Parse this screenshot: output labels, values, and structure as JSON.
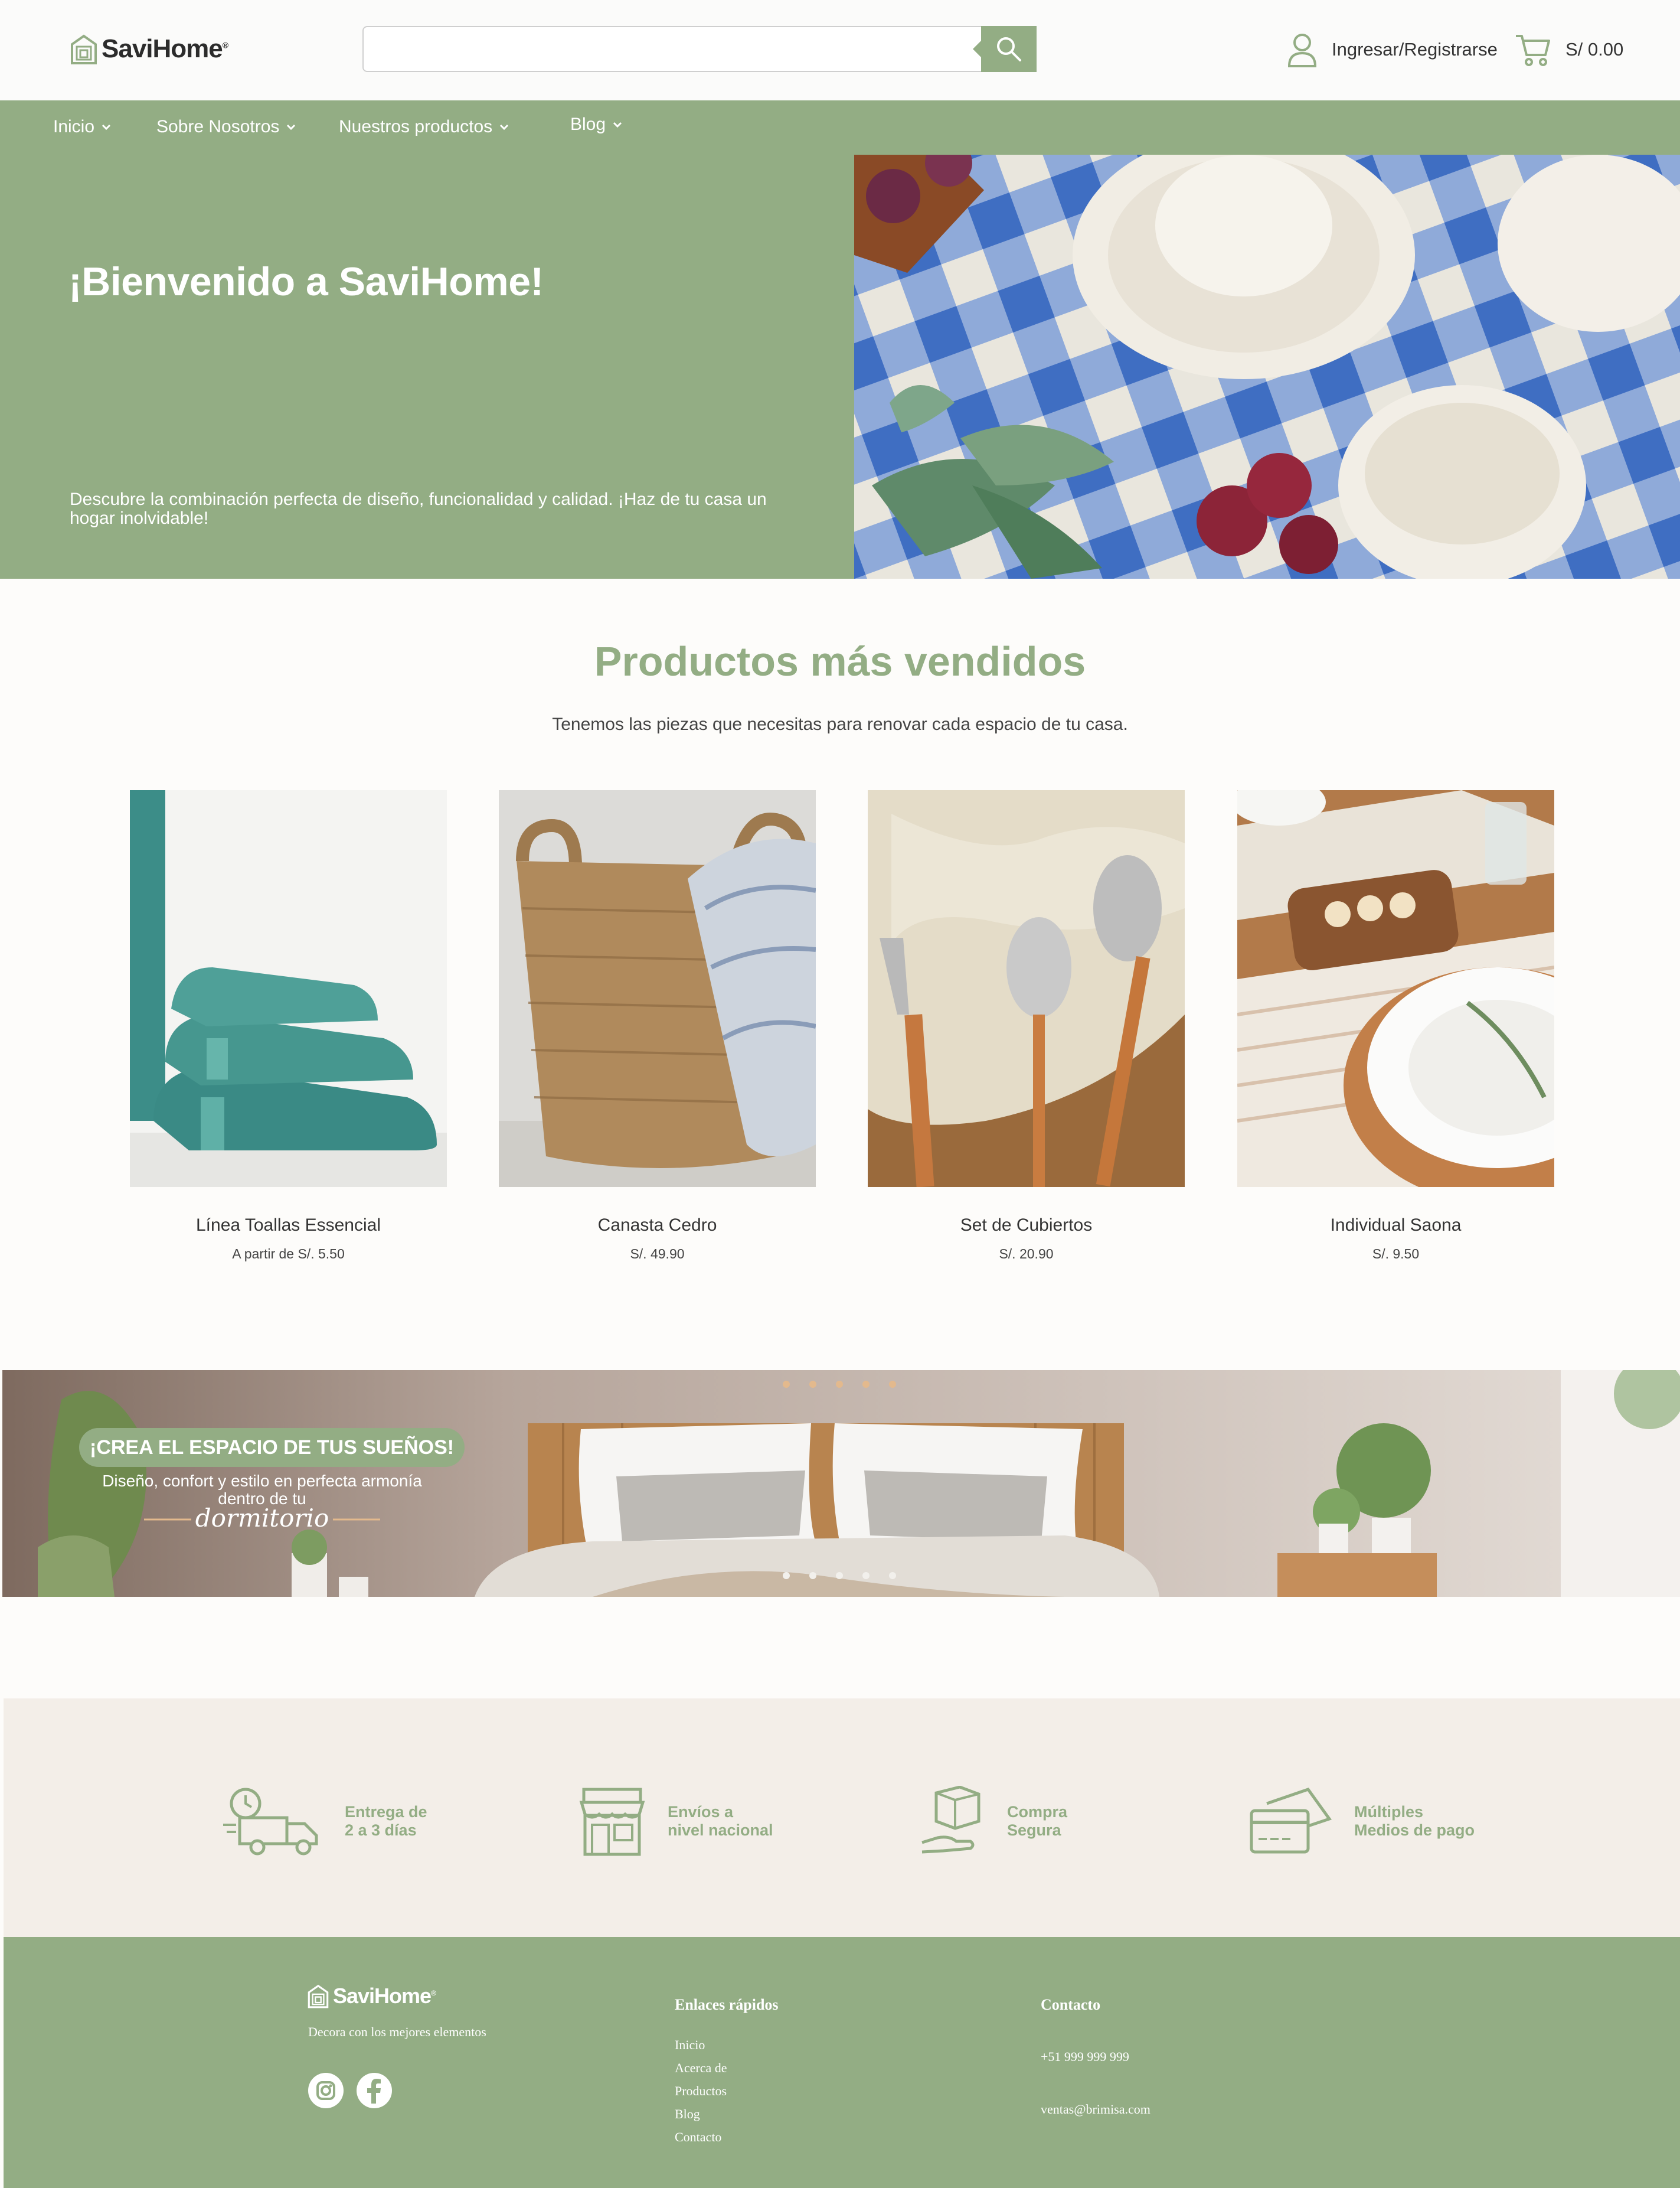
{
  "header": {
    "logo_text": "SaviHome",
    "logo_mark": "®",
    "search": {
      "placeholder": "",
      "value": ""
    },
    "login_label": "Ingresar/Registrarse",
    "cart_total": "S/ 0.00"
  },
  "nav": {
    "items": [
      {
        "label": "Inicio"
      },
      {
        "label": "Sobre Nosotros"
      },
      {
        "label": "Nuestros productos"
      },
      {
        "label": "Blog"
      }
    ]
  },
  "hero": {
    "title": "¡Bienvenido a SaviHome!",
    "subtitle": "Descubre la combinación perfecta de diseño, funcionalidad y calidad. ¡Haz de tu casa un hogar inolvidable!"
  },
  "bestsellers": {
    "title": "Productos más vendidos",
    "subtitle": "Tenemos las piezas que necesitas para renovar cada espacio de tu casa.",
    "products": [
      {
        "name": "Línea Toallas Essencial",
        "price": "A partir de S/. 5.50"
      },
      {
        "name": "Canasta Cedro",
        "price": "S/. 49.90"
      },
      {
        "name": "Set de Cubiertos",
        "price": "S/. 20.90"
      },
      {
        "name": "Individual Saona",
        "price": "S/. 9.50"
      }
    ]
  },
  "banner": {
    "badge": "¡CREA EL ESPACIO DE TUS SUEÑOS!",
    "line1": "Diseño, confort y estilo en perfecta armonía",
    "line2": "dentro de tu",
    "script": "dormitorio",
    "dot_count": 5
  },
  "features": [
    {
      "line1": "Entrega de",
      "line2": "2 a 3 días",
      "icon": "delivery-truck-icon"
    },
    {
      "line1": "Envíos a",
      "line2": "nivel nacional",
      "icon": "store-icon"
    },
    {
      "line1": "Compra",
      "line2": "Segura",
      "icon": "box-hand-icon"
    },
    {
      "line1": "Múltiples",
      "line2": "Medios de pago",
      "icon": "credit-card-icon"
    }
  ],
  "footer": {
    "logo_text": "SaviHome",
    "logo_mark": "®",
    "tagline": "Decora con los mejores elementos",
    "quick_links_title": "Enlaces rápidos",
    "quick_links": [
      "Inicio",
      "Acerca de",
      "Productos",
      "Blog",
      "Contacto"
    ],
    "contact_title": "Contacto",
    "phone": "+51 999 999 999",
    "email": "ventas@brimisa.com"
  },
  "colors": {
    "brand_green": "#93ad84",
    "feature_bg": "#f3eee8",
    "page_bg": "#fdfcfa",
    "dot": "#e3b98d"
  }
}
